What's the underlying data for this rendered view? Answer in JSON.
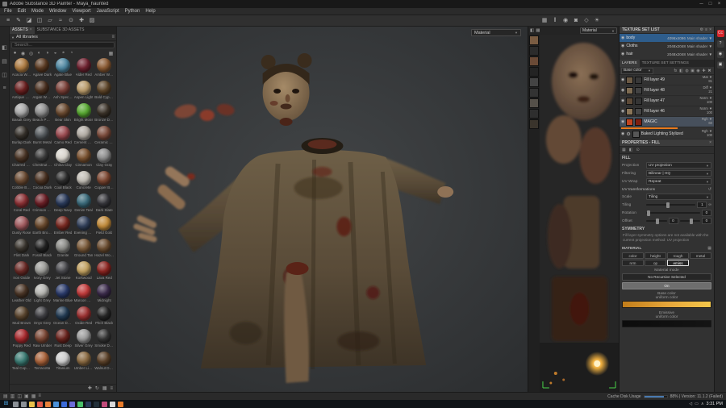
{
  "titlebar": {
    "title": "Adobe Substance 3D Painter - Maya_haunted",
    "window_controls": [
      {
        "name": "minimize-button",
        "glyph": "─"
      },
      {
        "name": "maximize-button",
        "glyph": "□"
      },
      {
        "name": "close-button",
        "glyph": "×"
      }
    ]
  },
  "menubar": {
    "items": [
      "File",
      "Edit",
      "Mode",
      "Window",
      "Viewport",
      "JavaScript",
      "Python",
      "Help"
    ]
  },
  "toolbar": {
    "left_icons": [
      {
        "name": "hamburger-menu-icon",
        "glyph": "≡"
      },
      {
        "name": "paint-tool-icon",
        "glyph": "✎"
      },
      {
        "name": "eraser-tool-icon",
        "glyph": "◪"
      },
      {
        "name": "projection-tool-icon",
        "glyph": "◫"
      },
      {
        "name": "polygon-fill-tool-icon",
        "glyph": "▱"
      },
      {
        "name": "smudge-tool-icon",
        "glyph": "≈"
      },
      {
        "name": "clone-tool-icon",
        "glyph": "⊙"
      },
      {
        "name": "material-picker-icon",
        "glyph": "✚"
      },
      {
        "name": "quick-mask-icon",
        "glyph": "▨"
      }
    ],
    "right_icons": [
      {
        "name": "display-settings-icon",
        "glyph": "▦"
      },
      {
        "name": "pause-engine-icon",
        "glyph": "‖"
      },
      {
        "name": "camera-rotation-icon",
        "glyph": "◉"
      },
      {
        "name": "snapshot-icon",
        "glyph": "◙"
      },
      {
        "name": "perspective-toggle-icon",
        "glyph": "◇"
      },
      {
        "name": "environment-light-icon",
        "glyph": "☀"
      }
    ]
  },
  "left_strip": {
    "icons": [
      {
        "name": "shelf-toggle-icon",
        "glyph": "◧"
      },
      {
        "name": "history-panel-icon",
        "glyph": "▤"
      },
      {
        "name": "display-settings-panel-icon",
        "glyph": "◫"
      },
      {
        "name": "log-panel-icon",
        "glyph": "≡"
      }
    ]
  },
  "assets": {
    "tab_assets": "ASSETS",
    "tab_substance": "SUBSTANCE 3D ASSETS",
    "library_label": "All libraries",
    "search_placeholder": "Search...",
    "filter_icons": [
      {
        "name": "filter-all-icon",
        "glyph": "●"
      },
      {
        "name": "filter-materials-icon",
        "glyph": "◉"
      },
      {
        "name": "filter-smart-materials-icon",
        "glyph": "◎"
      },
      {
        "name": "filter-smart-masks-icon",
        "glyph": "◐"
      },
      {
        "name": "filter-filters-icon",
        "glyph": "◑"
      },
      {
        "name": "filter-brushes-icon",
        "glyph": "◒"
      },
      {
        "name": "filter-alphas-icon",
        "glyph": "◓"
      },
      {
        "name": "filter-textures-icon",
        "glyph": "◔"
      },
      {
        "name": "grid-view-icon",
        "glyph": "▦"
      }
    ],
    "bottom_icons": [
      {
        "name": "import-resources-icon",
        "glyph": "✚"
      },
      {
        "name": "refresh-shelf-icon",
        "glyph": "↻"
      },
      {
        "name": "thumbnail-size-icon",
        "glyph": "▦"
      },
      {
        "name": "shelf-menu-icon",
        "glyph": "≡"
      }
    ],
    "materials": [
      {
        "name": "Acacia Wood",
        "color": "#ad7b42"
      },
      {
        "name": "Agave Dark",
        "color": "#5a3a22"
      },
      {
        "name": "Agate Blue",
        "color": "#4e86a0"
      },
      {
        "name": "Alder Red",
        "color": "#6e2230"
      },
      {
        "name": "Amber Wood",
        "color": "#8a5a33"
      },
      {
        "name": "Antique Red",
        "color": "#6b2020"
      },
      {
        "name": "Argan Wood",
        "color": "#4a3020"
      },
      {
        "name": "Ash Speckle",
        "color": "#7a4038"
      },
      {
        "name": "Aspen Light",
        "color": "#b89a6a"
      },
      {
        "name": "Bald Cypress",
        "color": "#5c4428"
      },
      {
        "name": "Basalt Grey",
        "color": "#a8a8a8"
      },
      {
        "name": "Beach Pebble",
        "color": "#8e8e8e"
      },
      {
        "name": "Bear Skin",
        "color": "#6a4a30"
      },
      {
        "name": "Bright Moss",
        "color": "#58a832"
      },
      {
        "name": "Bronze Dark",
        "color": "#3a3228"
      },
      {
        "name": "Burlap Dark",
        "color": "#35302a"
      },
      {
        "name": "Burnt Metal",
        "color": "#555a5e"
      },
      {
        "name": "Camo Red",
        "color": "#9a4a50"
      },
      {
        "name": "Cement Light",
        "color": "#b0aaa2"
      },
      {
        "name": "Ceramic Red",
        "color": "#7a4a3a"
      },
      {
        "name": "Charred Oak",
        "color": "#4a3526"
      },
      {
        "name": "Chestnut Dark",
        "color": "#3a3a3a"
      },
      {
        "name": "China Clay",
        "color": "#d8d4cc"
      },
      {
        "name": "Cinnamon",
        "color": "#7a5230"
      },
      {
        "name": "Clay Gray",
        "color": "#8a8a8a"
      },
      {
        "name": "Cobble Brown",
        "color": "#6a4a32"
      },
      {
        "name": "Cocoa Dark",
        "color": "#4a3222"
      },
      {
        "name": "Coal Black",
        "color": "#2c2c2c"
      },
      {
        "name": "Concrete",
        "color": "#c0bcb4"
      },
      {
        "name": "Copper Brown",
        "color": "#7a4530"
      },
      {
        "name": "Coral Red",
        "color": "#8a3034"
      },
      {
        "name": "Crimson Old",
        "color": "#6a1f26"
      },
      {
        "name": "Deep Navy",
        "color": "#2a3a5a"
      },
      {
        "name": "Denim Teal",
        "color": "#3a6a7a"
      },
      {
        "name": "Dark Slate",
        "color": "#35353a"
      },
      {
        "name": "Dusty Rose",
        "color": "#a05a5e"
      },
      {
        "name": "Earth Brown",
        "color": "#6a4a2e"
      },
      {
        "name": "Ember Red",
        "color": "#7a2a22"
      },
      {
        "name": "Evening Blue",
        "color": "#32405a"
      },
      {
        "name": "Field Gold",
        "color": "#c08a3a"
      },
      {
        "name": "Flint Dark",
        "color": "#3a352e"
      },
      {
        "name": "Fossil Black",
        "color": "#222222"
      },
      {
        "name": "Granite",
        "color": "#8a8a86"
      },
      {
        "name": "Ground Tan",
        "color": "#7a5a3a"
      },
      {
        "name": "Hazel Wood",
        "color": "#6a4c30"
      },
      {
        "name": "Iron Oxide",
        "color": "#6a2a26"
      },
      {
        "name": "Ivory Grey",
        "color": "#9a9a96"
      },
      {
        "name": "Jet Stone",
        "color": "#46464a"
      },
      {
        "name": "Korkwood",
        "color": "#c0a060"
      },
      {
        "name": "Lava Red",
        "color": "#8a2420"
      },
      {
        "name": "Leather Old",
        "color": "#4a3526"
      },
      {
        "name": "Light Grey",
        "color": "#b4b4b0"
      },
      {
        "name": "Marine Blue",
        "color": "#2a3a6a"
      },
      {
        "name": "Maroon Red",
        "color": "#c03a3a"
      },
      {
        "name": "Midnight",
        "color": "#3a2a4a"
      },
      {
        "name": "Mud Brown",
        "color": "#5a452e"
      },
      {
        "name": "Onyx Grey",
        "color": "#3e3e42"
      },
      {
        "name": "Ocean Deep",
        "color": "#223a52"
      },
      {
        "name": "Oxide Red",
        "color": "#9a3030"
      },
      {
        "name": "Pitch Black",
        "color": "#262626"
      },
      {
        "name": "Poppy Red",
        "color": "#a82a2e"
      },
      {
        "name": "Raw Umber",
        "color": "#7a4634"
      },
      {
        "name": "Rust Deep",
        "color": "#6a241e"
      },
      {
        "name": "Silver Grey",
        "color": "#9a9a9a"
      },
      {
        "name": "Smoke Dark",
        "color": "#343434"
      },
      {
        "name": "Teal Copper",
        "color": "#3a7a72"
      },
      {
        "name": "Terracotta",
        "color": "#a8623a"
      },
      {
        "name": "Titanium",
        "color": "#cccccc"
      },
      {
        "name": "Umber Light",
        "color": "#8a6a42"
      },
      {
        "name": "Walnut Dark",
        "color": "#5a4028"
      }
    ]
  },
  "viewport3d": {
    "shading_dropdown": "Material"
  },
  "view2d": {
    "shading_dropdown": "Material",
    "toolbar_icons": [
      {
        "name": "uv-grid-icon",
        "glyph": "▦"
      },
      {
        "name": "uv-filter-icon",
        "glyph": "◧"
      }
    ],
    "thumbnails": [
      "#7a5c42",
      "#2b2b2b",
      "#6a4a36",
      "#232323",
      "#444444",
      "#333333",
      "#555049",
      "#2e2e2e",
      "#3a342c"
    ]
  },
  "texture_set_list": {
    "title": "TEXTURE SET LIST",
    "header_icons": [
      {
        "name": "tsl-settings-icon",
        "glyph": "⚙"
      },
      {
        "name": "tsl-menu-icon",
        "glyph": "≡"
      },
      {
        "name": "tsl-close-icon",
        "glyph": "×"
      }
    ],
    "rows": [
      {
        "name": "body",
        "resolution": "4096x4096",
        "shader": "Main shader",
        "selected": true
      },
      {
        "name": "Cloths",
        "resolution": "2048x2048",
        "shader": "Main shader",
        "selected": false
      },
      {
        "name": "hair",
        "resolution": "2048x2048",
        "shader": "Main shader",
        "selected": false
      }
    ]
  },
  "layers_panel": {
    "tab_layers": "LAYERS",
    "tab_settings": "TEXTURE SET SETTINGS",
    "channel_dropdown": "Base color",
    "header_icons": [
      {
        "name": "add-effect-icon",
        "glyph": "fx"
      },
      {
        "name": "add-mask-icon",
        "glyph": "◧"
      },
      {
        "name": "add-smart-material-icon",
        "glyph": "◍"
      },
      {
        "name": "add-folder-icon",
        "glyph": "▣"
      },
      {
        "name": "add-fill-layer-icon",
        "glyph": "◉"
      },
      {
        "name": "add-layer-icon",
        "glyph": "✚"
      },
      {
        "name": "delete-layer-icon",
        "glyph": "✖"
      }
    ],
    "layers": [
      {
        "name": "Fill layer 49",
        "blend": "Mat",
        "opacity": "81",
        "thumbs": [
          "#6b5a45",
          "#383838"
        ],
        "selected": false
      },
      {
        "name": "Fill layer 48",
        "blend": "Diff",
        "opacity": "21",
        "thumbs": [
          "#7d6b52",
          "#424242"
        ],
        "selected": false
      },
      {
        "name": "Fill layer 47",
        "blend": "Norm",
        "opacity": "100",
        "thumbs": [
          "#5c4a38",
          "#353535"
        ],
        "selected": false
      },
      {
        "name": "Fill layer 46",
        "blend": "Norm",
        "opacity": "100",
        "thumbs": [
          "#8a7558",
          "#464646"
        ],
        "selected": false
      },
      {
        "name": "MAGIC",
        "blend": "Rgh",
        "opacity": "60",
        "thumbs": [
          "#c2441f",
          "#7e1f10"
        ],
        "selected": true
      },
      {
        "name": "Baked Lighting Stylized",
        "blend": "Rgh",
        "opacity": "100",
        "thumbs": [
          "#565656"
        ],
        "icon": "gear",
        "selected": false
      }
    ]
  },
  "properties": {
    "title": "PROPERTIES - FILL",
    "close_glyph": "×",
    "tab_icons": [
      {
        "name": "props-material-tab-icon",
        "glyph": "▦"
      },
      {
        "name": "props-mask-tab-icon",
        "glyph": "◧"
      },
      {
        "name": "props-view-tab-icon",
        "glyph": "⊙"
      }
    ],
    "fill": {
      "section_title": "FILL",
      "projection_label": "Projection",
      "projection_value": "UV projection",
      "filtering_label": "Filtering",
      "filtering_value": "Bilinear | HQ",
      "uv_wrap_label": "UV Wrap",
      "uv_wrap_value": "Repeat",
      "uv_transform_title": "UV transformations",
      "scale_label": "Scale",
      "scale_value": "Tiling",
      "tiling_label": "Tiling",
      "tiling_value": "1",
      "rotation_label": "Rotation",
      "rotation_value": "0",
      "offset_label": "Offset",
      "offset_x": "0",
      "offset_y": "0"
    },
    "symmetry": {
      "title": "SYMMETRY",
      "note": "Fill layer symmetry options are not available with the current projection method: UV projection"
    },
    "material": {
      "title": "MATERIAL",
      "channels": [
        "color",
        "height",
        "rough",
        "metal",
        "nrm",
        "op",
        "emiss"
      ],
      "selected_channel": "emiss",
      "mode_label": "Material mode",
      "mode_value": "No Recursive Selected",
      "toggle_label": "On",
      "base_color_label": "Base color",
      "base_color_type": "uniform color",
      "base_color_hex": "#e8a93c",
      "emissive_label": "Emissive",
      "emissive_type": "uniform color",
      "emissive_hex": "#141414"
    }
  },
  "right_strip": {
    "icons": [
      {
        "name": "creative-cloud-icon",
        "glyph": "Cc",
        "color": "#d8272c"
      },
      {
        "name": "help-icon",
        "glyph": "?",
        "color": "#3a3a3a"
      },
      {
        "name": "notifications-icon",
        "glyph": "◉",
        "color": "#3a3a3a"
      },
      {
        "name": "panels-icon",
        "glyph": "▣",
        "color": "#3a3a3a"
      }
    ]
  },
  "statusbar": {
    "icons": [
      {
        "name": "shelf-panel-icon",
        "glyph": "▤"
      },
      {
        "name": "layers-panel-icon",
        "glyph": "▥"
      },
      {
        "name": "properties-panel-icon",
        "glyph": "◫"
      },
      {
        "name": "viewer-panel-icon",
        "glyph": "▣"
      },
      {
        "name": "texture-panel-icon",
        "glyph": "▦"
      },
      {
        "name": "log-icon",
        "glyph": "≡"
      }
    ],
    "cache_label": "Cache Disk Usage",
    "cache_percent": 88,
    "status_text": "88% | Version: 11.1.2 (Failed)"
  },
  "taskbar": {
    "start_glyph": "⊞",
    "apps": [
      {
        "name": "search-icon",
        "color": "#8a9096"
      },
      {
        "name": "task-view-icon",
        "color": "#8a9096"
      },
      {
        "name": "file-explorer-icon",
        "color": "#e8c04a"
      },
      {
        "name": "chrome-icon",
        "color": "#e05a4a"
      },
      {
        "name": "firefox-icon",
        "color": "#e8823a"
      },
      {
        "name": "edge-icon",
        "color": "#4a90d8"
      },
      {
        "name": "vscode-icon",
        "color": "#3a6ad8"
      },
      {
        "name": "discord-icon",
        "color": "#6a6ad8"
      },
      {
        "name": "spotify-icon",
        "color": "#4ac06a"
      },
      {
        "name": "photoshop-icon",
        "color": "#2a3a5a"
      },
      {
        "name": "steam-icon",
        "color": "#22303a"
      },
      {
        "name": "slack-icon",
        "color": "#c04a7a"
      },
      {
        "name": "notepad-icon",
        "color": "#d8d8d8"
      },
      {
        "name": "blender-icon",
        "color": "#e87b2a"
      }
    ],
    "tray_icons": [
      {
        "name": "tray-expand-icon",
        "glyph": "∧"
      },
      {
        "name": "network-icon",
        "glyph": "▭"
      },
      {
        "name": "volume-icon",
        "glyph": "◁"
      }
    ],
    "time": "3:31 PM"
  }
}
